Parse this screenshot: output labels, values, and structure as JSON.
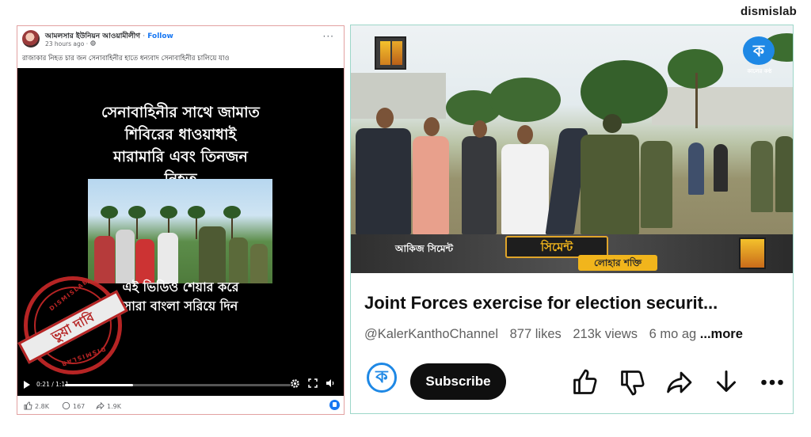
{
  "brand": "dismislab",
  "facebook": {
    "page_name": "আমলসার ইউনিয়ন আওয়ামীলীগ",
    "dot": "·",
    "follow": "Follow",
    "time": "23 hours ago · ",
    "more": "···",
    "caption": "রাজাকার নিহত চার জন সেনাবাহিনীর হাতে ধন্যবাদ সেনাবাহিনীর চালিয়ে যাও",
    "video": {
      "title_lines": [
        "সেনাবাহিনীর সাথে জামাত",
        "শিবিরের ধাওয়াধাই",
        "মারামারি এবং তিনজন",
        "নিহত"
      ],
      "bottom_lines": [
        "এই ভিডিও শেয়ার করে",
        "সারা বাংলা সরিয়ে দিন"
      ],
      "timecode": "0:21 / 1:11",
      "progress": 0.3
    },
    "reactions": "2.8K",
    "comments": "167",
    "shares": "1.9K"
  },
  "stamp": {
    "top_text": "DISMISLAB",
    "bottom_text": "DISMISLAB",
    "label": "ভুয়া দাবি",
    "color": "#c62828"
  },
  "youtube": {
    "channel_logo_letter": "ক",
    "channel_logo_sub": "কালের কণ্ঠ",
    "ad": {
      "left": "আকিজ সিমেন্ট",
      "mid": "সিমেন্ট",
      "right": "লোহার শক্তি"
    },
    "title": "Joint Forces exercise for election securit...",
    "handle": "@KalerKanthoChannel",
    "likes": "877 likes",
    "views": "213k views",
    "age": "6 mo ag",
    "more": "...more",
    "subscribe": "Subscribe",
    "icons": [
      "like-icon",
      "dislike-icon",
      "share-icon",
      "download-icon",
      "more-icon"
    ]
  }
}
